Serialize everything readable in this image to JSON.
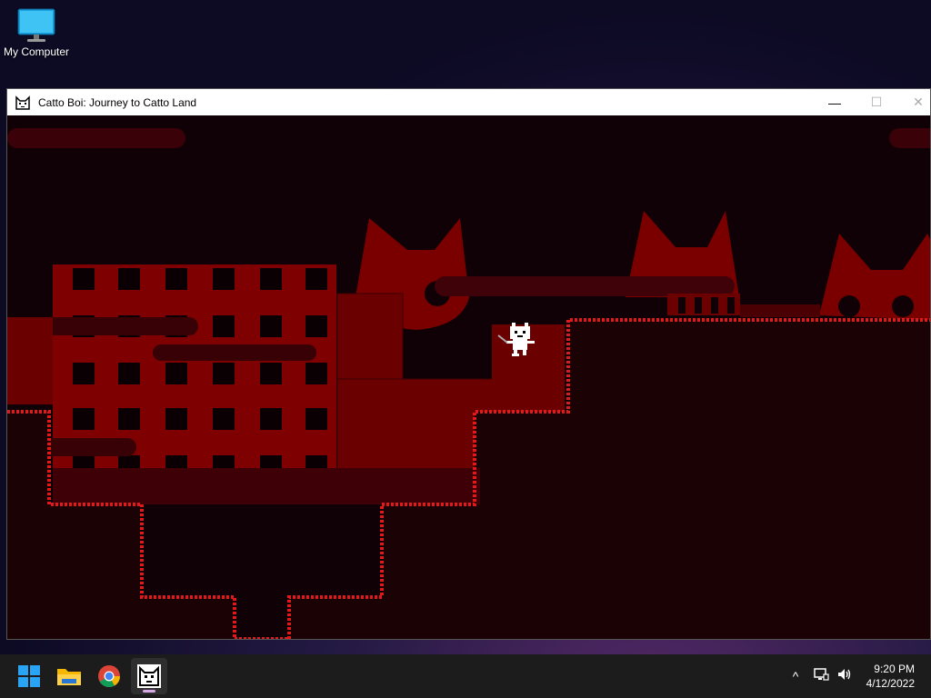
{
  "desktop": {
    "icons": [
      {
        "label": "My Computer",
        "icon": "monitor-icon"
      }
    ]
  },
  "window": {
    "title": "Catto Boi: Journey to Catto Land",
    "controls": {
      "minimize": "—",
      "maximize": "☐",
      "close": "✕"
    }
  },
  "game": {
    "palette": {
      "sky": "#0f0206",
      "building": "#8a0000",
      "ground": "#1a0205",
      "grass": "#e01010",
      "cat_silhouette": "#7a0000"
    },
    "player": "white pixel cat with sword"
  },
  "taskbar": {
    "apps": [
      {
        "name": "start",
        "icon": "windows-start-icon"
      },
      {
        "name": "file-explorer",
        "icon": "folder-icon"
      },
      {
        "name": "chrome",
        "icon": "chrome-icon"
      },
      {
        "name": "catto-boi",
        "icon": "catto-boi-icon",
        "active": true
      }
    ],
    "tray": {
      "chevron": "^",
      "network": "network-icon",
      "volume": "volume-icon"
    },
    "clock": {
      "time": "9:20 PM",
      "date": "4/12/2022"
    }
  }
}
